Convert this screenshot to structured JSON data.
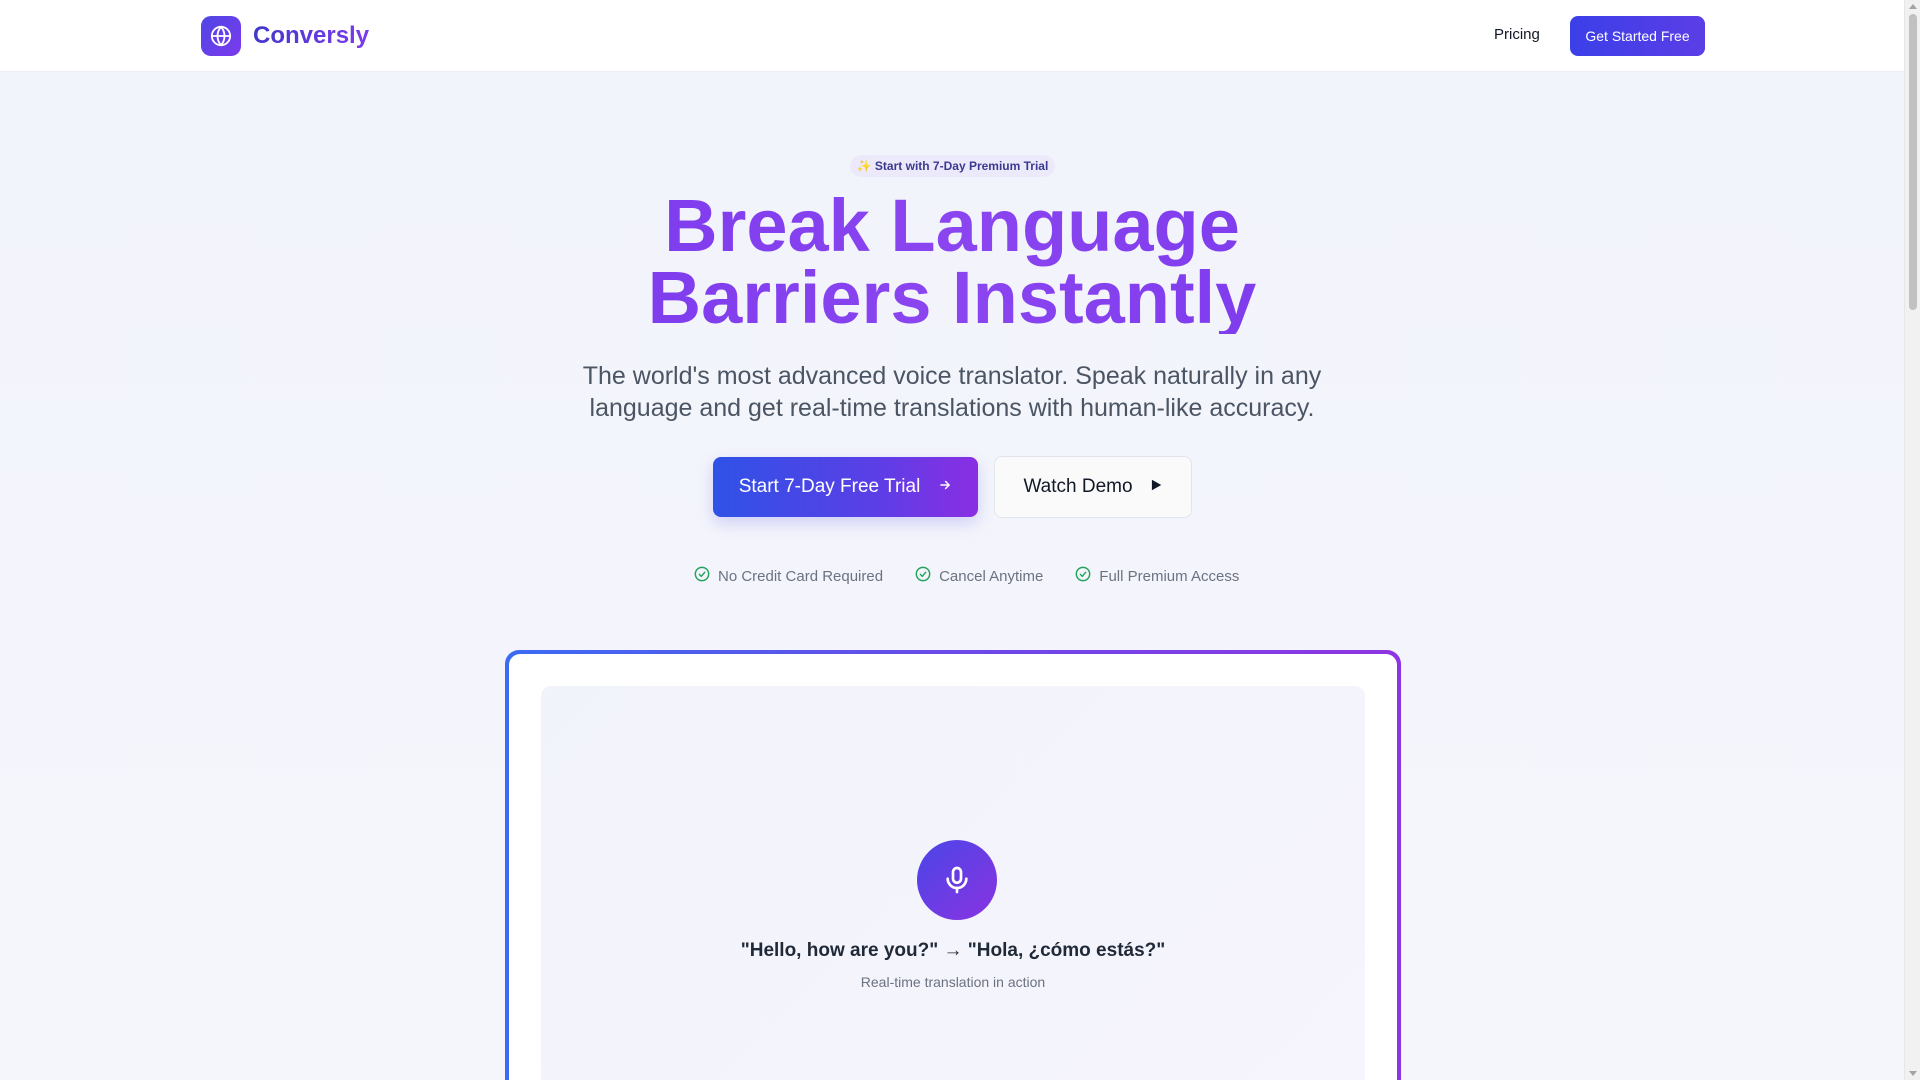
{
  "header": {
    "brand": "Conversly",
    "logo_icon": "globe-icon",
    "nav_pricing": "Pricing",
    "cta_label": "Get Started Free"
  },
  "hero": {
    "badge": "✨ Start with 7-Day Premium Trial",
    "title_line1": "Break Language",
    "title_line2": "Barriers Instantly",
    "subtitle_line1": "The world's most advanced voice translator. Speak naturally in any",
    "subtitle_line2": "language and get real-time translations with human-like accuracy.",
    "primary_button": "Start 7-Day Free Trial",
    "primary_button_icon": "arrow-right-icon",
    "secondary_button": "Watch Demo",
    "secondary_button_icon": "play-icon",
    "perks": [
      {
        "label": "No Credit Card Required",
        "icon": "check-circle-icon"
      },
      {
        "label": "Cancel Anytime",
        "icon": "check-circle-icon"
      },
      {
        "label": "Full Premium Access",
        "icon": "check-circle-icon"
      }
    ]
  },
  "demo": {
    "mic_icon": "microphone-icon",
    "phrase": "\"Hello, how are you?\" → \"Hola, ¿cómo estás?\"",
    "caption": "Real-time translation in action"
  },
  "colors": {
    "brand_indigo": "#4f46e5",
    "brand_purple": "#7c3aed",
    "check_green": "#22a35a"
  }
}
